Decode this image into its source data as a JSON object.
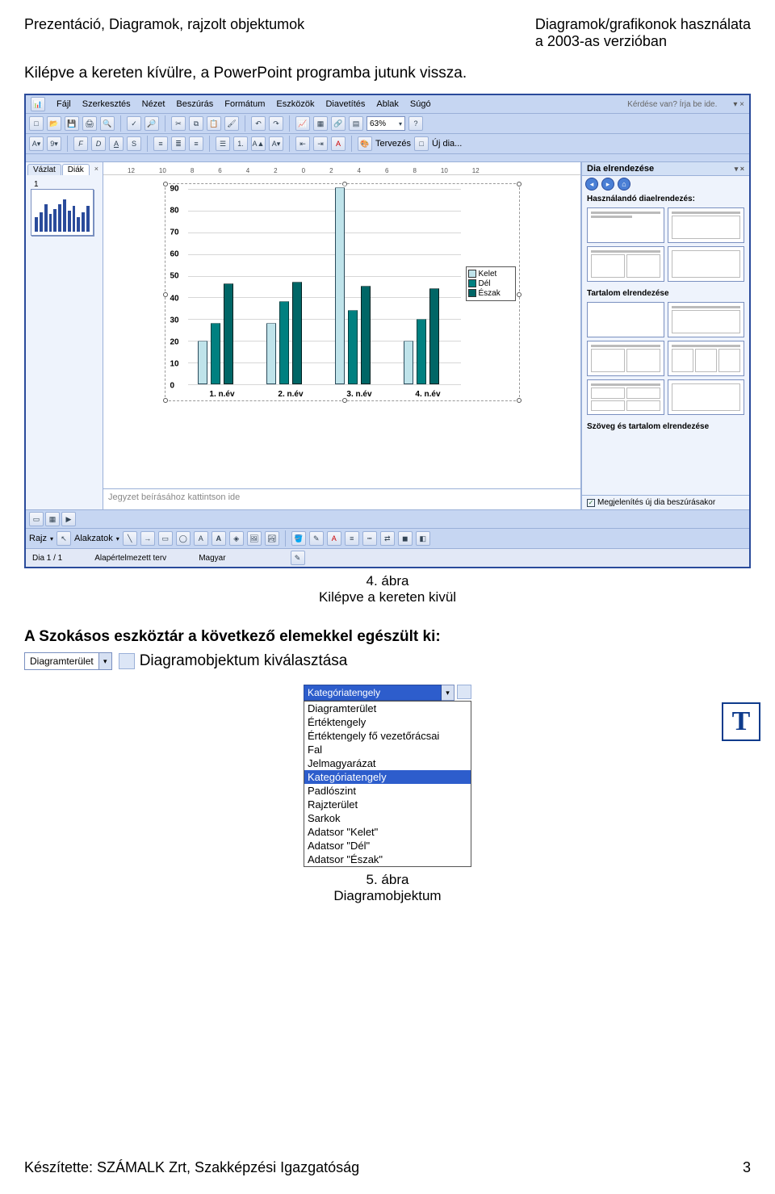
{
  "header": {
    "left": "Prezentáció, Diagramok, rajzolt objektumok",
    "right_line1": "Diagramok/grafikonok    használata",
    "right_line2": "a 2003-as verzióban"
  },
  "para1": "Kilépve a kereten kívülre, a PowerPoint programba jutunk vissza.",
  "ppwin": {
    "menus": [
      "Fájl",
      "Szerkesztés",
      "Nézet",
      "Beszúrás",
      "Formátum",
      "Eszközök",
      "Diavetítés",
      "Ablak",
      "Súgó"
    ],
    "question": "Kérdése van? Írja be ide.",
    "zoom": "63%",
    "toolbar2_labels": {
      "tervezes": "Tervezés",
      "ujdia": "Új dia..."
    },
    "side_tabs": {
      "vazlat": "Vázlat",
      "diak": "Diák"
    },
    "thumb_num": "1",
    "ruler_ticks": [
      "12",
      "10",
      "8",
      "6",
      "4",
      "2",
      "0",
      "2",
      "4",
      "6",
      "8",
      "10",
      "12"
    ],
    "notes_placeholder": "Jegyzet beírásához kattintson ide",
    "taskpane": {
      "title": "Dia elrendezése",
      "section1": "Használandó diaelrendezés:",
      "section2": "Tartalom elrendezése",
      "section3": "Szöveg és tartalom elrendezése",
      "footer_cb": "Megjelenítés új dia beszúrásakor"
    },
    "drawbar": {
      "rajz": "Rajz",
      "alakzatok": "Alakzatok"
    },
    "status": {
      "dia": "Dia 1 / 1",
      "terv": "Alapértelmezett terv",
      "lang": "Magyar"
    }
  },
  "chart_data": {
    "type": "bar",
    "categories": [
      "1. n.év",
      "2. n.év",
      "3. n.év",
      "4. n.év"
    ],
    "series": [
      {
        "name": "Kelet",
        "values": [
          20,
          28,
          90,
          20
        ]
      },
      {
        "name": "Dél",
        "values": [
          28,
          38,
          34,
          30
        ]
      },
      {
        "name": "Észak",
        "values": [
          46,
          47,
          45,
          44
        ]
      }
    ],
    "ylabel": "",
    "xlabel": "",
    "ylim": [
      0,
      90
    ],
    "yticks": [
      0,
      10,
      20,
      30,
      40,
      50,
      60,
      70,
      80,
      90
    ],
    "legend": [
      "Kelet",
      "Dél",
      "Észak"
    ]
  },
  "fig4": {
    "num": "4. ábra",
    "cap": "Kilépve a kereten kivül"
  },
  "section2": "A Szokásos eszköztár a következő elemekkel egészült ki:",
  "combo1": {
    "label": "Diagramterület",
    "text": " Diagramobjektum kiválasztása"
  },
  "ddl": {
    "selected": "Kategóriatengely",
    "items": [
      "Diagramterület",
      "Értéktengely",
      "Értéktengely fő vezetőrácsai",
      "Fal",
      "Jelmagyarázat",
      "Kategóriatengely",
      "Padlószint",
      "Rajzterület",
      "Sarkok",
      "Adatsor \"Kelet\"",
      "Adatsor \"Dél\"",
      "Adatsor \"Észak\""
    ],
    "highlight_index": 5
  },
  "fig5": {
    "num": "5. ábra",
    "cap": "Diagramobjektum"
  },
  "footer": {
    "left": "Készítette: SZÁMALK Zrt, Szakképzési Igazgatóság",
    "page": "3"
  }
}
